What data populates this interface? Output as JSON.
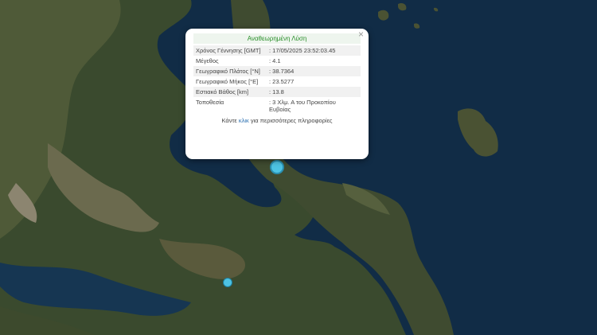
{
  "popup": {
    "title": "Αναθεωρημένη Λύση",
    "close": "×",
    "rows": [
      {
        "label": "Χρόνος Γέννησης [GMT]",
        "value": ": 17/05/2025 23:52:03.45"
      },
      {
        "label": "Μέγεθος",
        "value": ": 4.1"
      },
      {
        "label": "Γεωγραφικό Πλάτος [°N]",
        "value": ": 38.7364"
      },
      {
        "label": "Γεωγραφικό Μήκος [°E]",
        "value": ": 23.5277"
      },
      {
        "label": "Εστιακό Βάθος [km]",
        "value": ": 13.8"
      },
      {
        "label": "Τοποθεσία",
        "value": ": 3 Χλμ. Α του Προκοπίου Ευβοίας"
      }
    ],
    "footer_pre": "Κάντε ",
    "footer_link": "κλικ",
    "footer_post": " για περισσότερες πληροφορίες"
  },
  "colors": {
    "sea": "#0f2a44",
    "marker": "#4dc3e3"
  }
}
